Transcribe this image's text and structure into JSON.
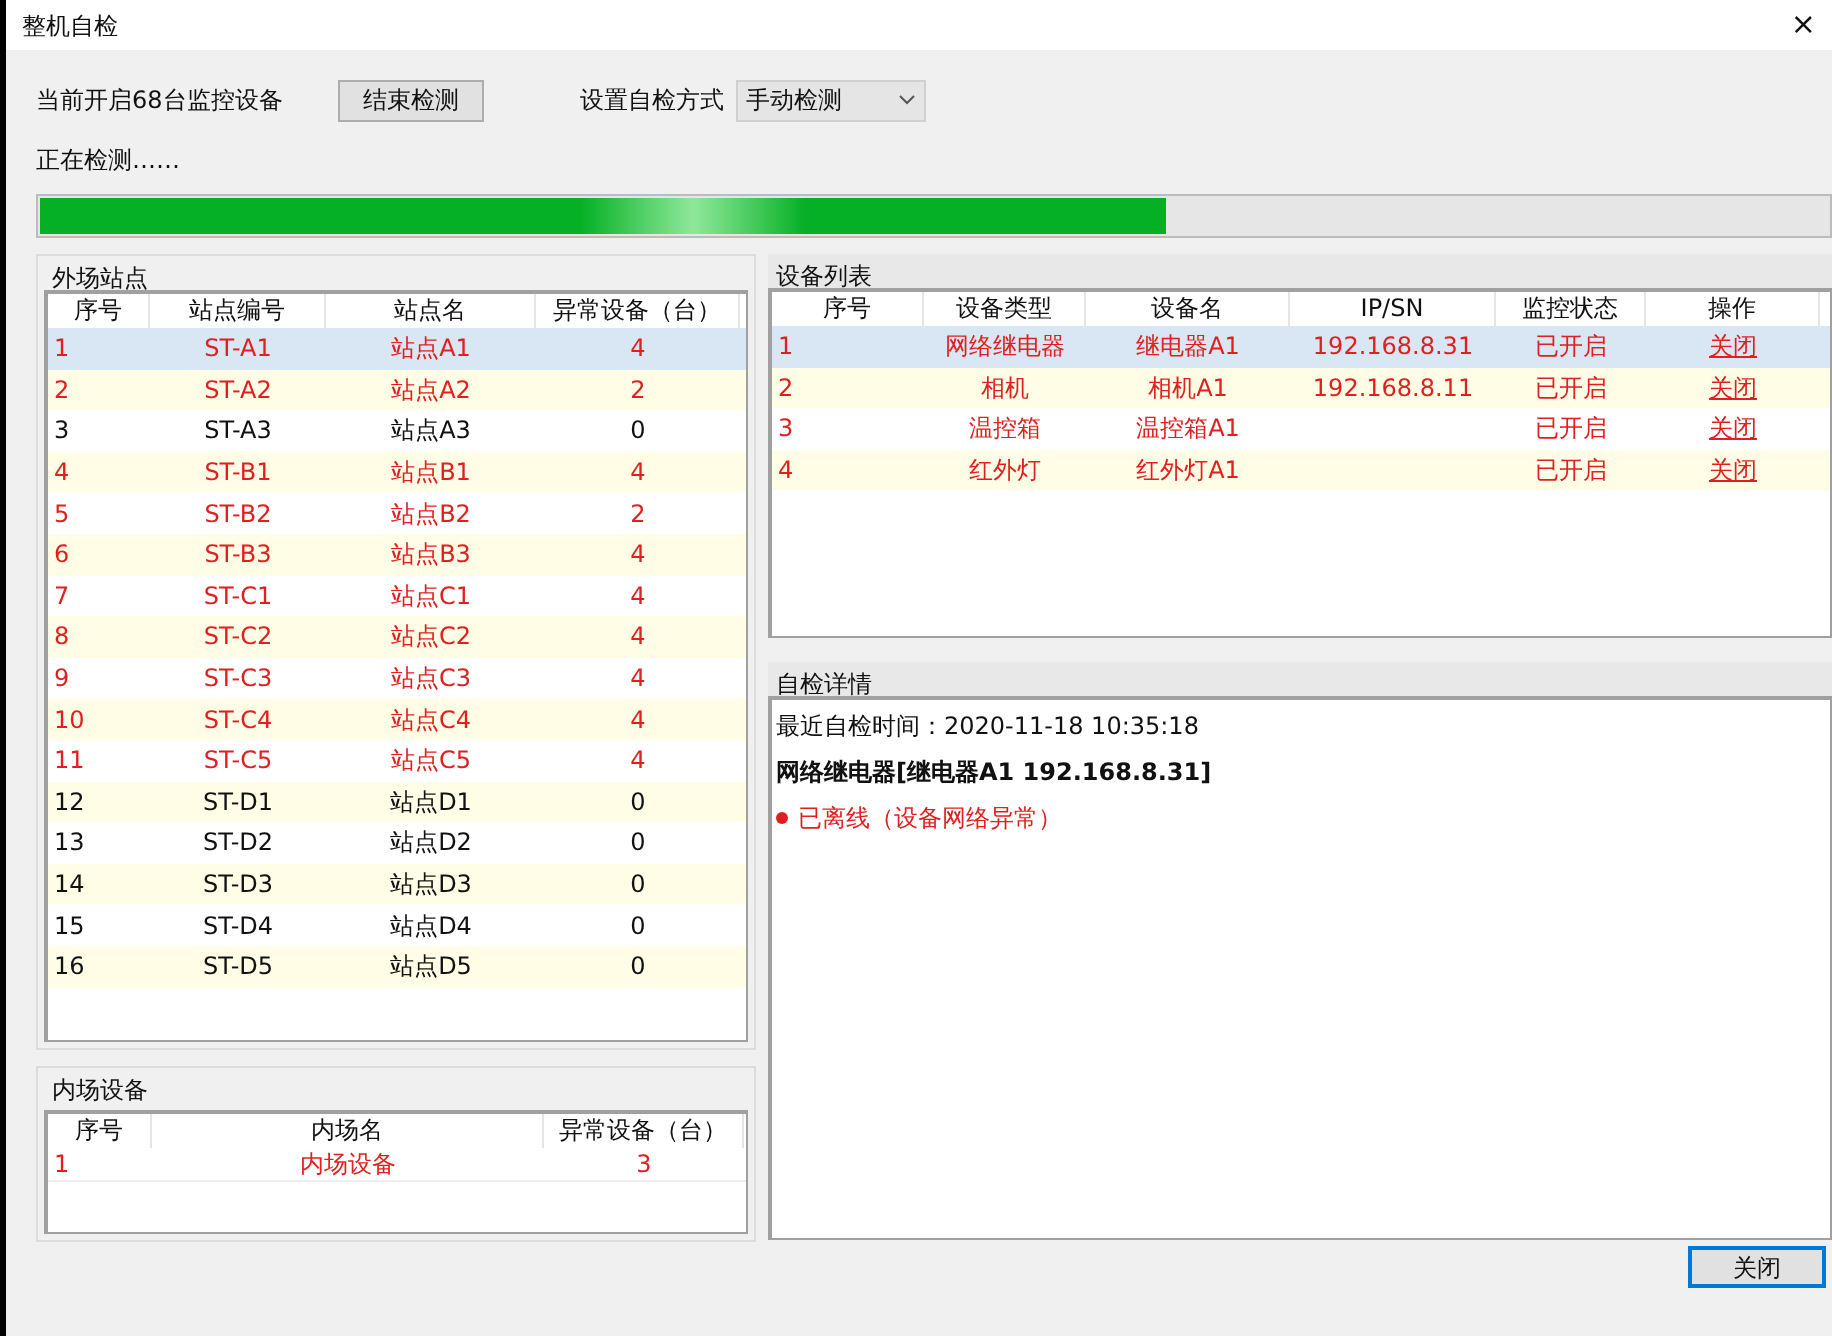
{
  "window": {
    "title": "整机自检",
    "close": "×"
  },
  "toolbar": {
    "device_count": "当前开启68台监控设备",
    "stop_button": "结束检测",
    "mode_label": "设置自检方式",
    "mode_value": "手动检测"
  },
  "progress": {
    "label": "正在检测……",
    "level": 0.63
  },
  "outfield": {
    "title": "外场站点",
    "columns": [
      "序号",
      "站点编号",
      "站点名",
      "异常设备（台）"
    ],
    "rows": [
      {
        "no": "1",
        "code": "ST-A1",
        "name": "站点A1",
        "abnormal": "4",
        "alert": true,
        "selected": true
      },
      {
        "no": "2",
        "code": "ST-A2",
        "name": "站点A2",
        "abnormal": "2",
        "alert": true,
        "selected": false
      },
      {
        "no": "3",
        "code": "ST-A3",
        "name": "站点A3",
        "abnormal": "0",
        "alert": false,
        "selected": false
      },
      {
        "no": "4",
        "code": "ST-B1",
        "name": "站点B1",
        "abnormal": "4",
        "alert": true,
        "selected": false
      },
      {
        "no": "5",
        "code": "ST-B2",
        "name": "站点B2",
        "abnormal": "2",
        "alert": true,
        "selected": false
      },
      {
        "no": "6",
        "code": "ST-B3",
        "name": "站点B3",
        "abnormal": "4",
        "alert": true,
        "selected": false
      },
      {
        "no": "7",
        "code": "ST-C1",
        "name": "站点C1",
        "abnormal": "4",
        "alert": true,
        "selected": false
      },
      {
        "no": "8",
        "code": "ST-C2",
        "name": "站点C2",
        "abnormal": "4",
        "alert": true,
        "selected": false
      },
      {
        "no": "9",
        "code": "ST-C3",
        "name": "站点C3",
        "abnormal": "4",
        "alert": true,
        "selected": false
      },
      {
        "no": "10",
        "code": "ST-C4",
        "name": "站点C4",
        "abnormal": "4",
        "alert": true,
        "selected": false
      },
      {
        "no": "11",
        "code": "ST-C5",
        "name": "站点C5",
        "abnormal": "4",
        "alert": true,
        "selected": false
      },
      {
        "no": "12",
        "code": "ST-D1",
        "name": "站点D1",
        "abnormal": "0",
        "alert": false,
        "selected": false
      },
      {
        "no": "13",
        "code": "ST-D2",
        "name": "站点D2",
        "abnormal": "0",
        "alert": false,
        "selected": false
      },
      {
        "no": "14",
        "code": "ST-D3",
        "name": "站点D3",
        "abnormal": "0",
        "alert": false,
        "selected": false
      },
      {
        "no": "15",
        "code": "ST-D4",
        "name": "站点D4",
        "abnormal": "0",
        "alert": false,
        "selected": false
      },
      {
        "no": "16",
        "code": "ST-D5",
        "name": "站点D5",
        "abnormal": "0",
        "alert": false,
        "selected": false
      }
    ]
  },
  "infield": {
    "title": "内场设备",
    "columns": [
      "序号",
      "内场名",
      "异常设备（台）"
    ],
    "rows": [
      {
        "no": "1",
        "name": "内场设备",
        "abnormal": "3",
        "alert": true
      }
    ]
  },
  "devices": {
    "title": "设备列表",
    "columns": [
      "序号",
      "设备类型",
      "设备名",
      "IP/SN",
      "监控状态",
      "操作"
    ],
    "rows": [
      {
        "no": "1",
        "type": "网络继电器",
        "name": "继电器A1",
        "ip": "192.168.8.31",
        "status": "已开启",
        "action": "关闭",
        "alert": true,
        "selected": true
      },
      {
        "no": "2",
        "type": "相机",
        "name": "相机A1",
        "ip": "192.168.8.11",
        "status": "已开启",
        "action": "关闭",
        "alert": true,
        "selected": false
      },
      {
        "no": "3",
        "type": "温控箱",
        "name": "温控箱A1",
        "status": "已开启",
        "action": "关闭",
        "alert": true,
        "selected": false
      },
      {
        "no": "4",
        "type": "红外灯",
        "name": "红外灯A1",
        "status": "已开启",
        "action": "关闭",
        "alert": true,
        "selected": false
      }
    ]
  },
  "details": {
    "title": "自检详情",
    "time": "最近自检时间：2020-11-18 10:35:18",
    "device": "网络继电器[继电器A1 192.168.8.31]",
    "issues": [
      {
        "text": "已离线（设备网络异常）",
        "color": "#e02020"
      }
    ]
  },
  "footer": {
    "close_button": "关闭"
  }
}
